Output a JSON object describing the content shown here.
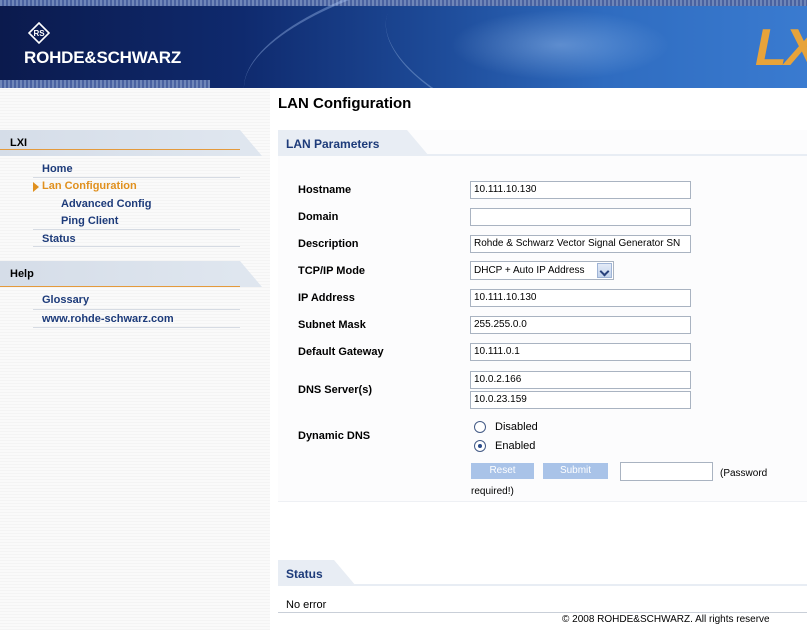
{
  "header": {
    "brand": "ROHDE&SCHWARZ",
    "badge": "LX"
  },
  "sidebar": {
    "sections": [
      {
        "title": "LXI",
        "items": [
          {
            "label": "Home"
          },
          {
            "label": "Lan Configuration",
            "active": true
          },
          {
            "label": "Advanced Config"
          },
          {
            "label": "Ping Client"
          },
          {
            "label": "Status"
          }
        ]
      },
      {
        "title": "Help",
        "items": [
          {
            "label": "Glossary"
          },
          {
            "label": "www.rohde-schwarz.com"
          }
        ]
      }
    ]
  },
  "main": {
    "page_title": "LAN Configuration",
    "lan_params": {
      "section_title": "LAN Parameters",
      "hostname": {
        "label": "Hostname",
        "value": "10.111.10.130"
      },
      "domain": {
        "label": "Domain",
        "value": ""
      },
      "description": {
        "label": "Description",
        "value": "Rohde & Schwarz Vector Signal Generator SN"
      },
      "tcpip_mode": {
        "label": "TCP/IP Mode",
        "value": "DHCP + Auto IP Address"
      },
      "ip_address": {
        "label": "IP Address",
        "value": "10.111.10.130"
      },
      "subnet_mask": {
        "label": "Subnet Mask",
        "value": "255.255.0.0"
      },
      "default_gateway": {
        "label": "Default Gateway",
        "value": "10.111.0.1"
      },
      "dns_servers": {
        "label": "DNS Server(s)",
        "values": [
          "10.0.2.166",
          "10.0.23.159"
        ]
      },
      "dynamic_dns": {
        "label": "Dynamic DNS",
        "options": [
          {
            "label": "Disabled",
            "checked": false
          },
          {
            "label": "Enabled",
            "checked": true
          }
        ]
      },
      "reset_label": "Reset",
      "submit_label": "Submit",
      "password_value": "",
      "password_note_1": "(Password",
      "password_note_2": "required!)"
    },
    "status": {
      "section_title": "Status",
      "text": "No error"
    },
    "footer": "© 2008 ROHDE&SCHWARZ. All rights reserve"
  },
  "colors": {
    "accent_orange": "#e0901e",
    "link_blue": "#1d3b7a",
    "button_blue": "#a9c3e8"
  }
}
